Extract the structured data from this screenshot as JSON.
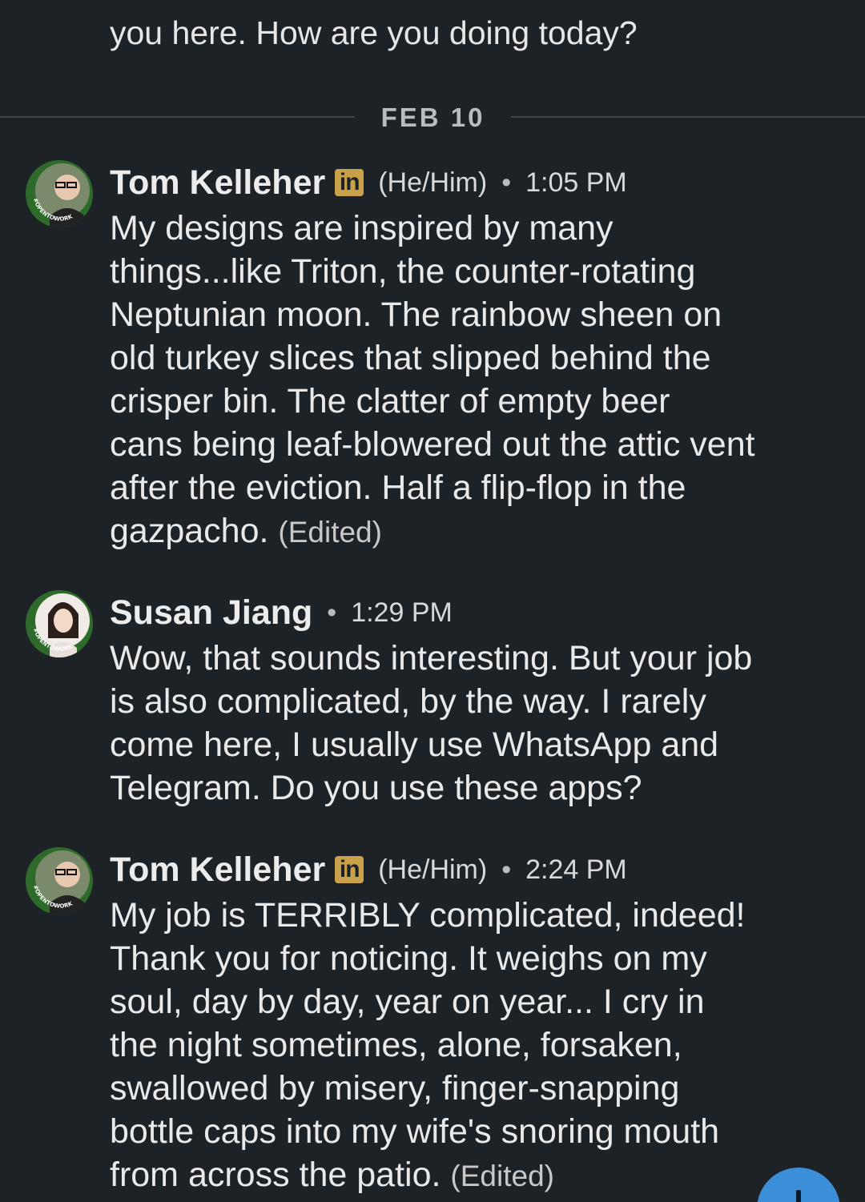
{
  "previous_message": {
    "text_tail": "you here. How are you doing today?"
  },
  "date_divider": "FEB 10",
  "messages": [
    {
      "sender": "Tom Kelleher",
      "badge": "in",
      "pronouns": "(He/Him)",
      "separator": "•",
      "time": "1:05 PM",
      "avatar_icon": "avatar-opentowork-frame",
      "avatar_frame_text": "#OPENTOWORK",
      "text": "My designs are inspired by many\nthings...like Triton, the counter-rotating\nNeptunian moon.  The rainbow sheen on\nold turkey slices that slipped behind the\ncrisper bin.  The clatter of empty beer\ncans being leaf-blowered out the attic vent\nafter the eviction.  Half a flip-flop in the\ngazpacho.",
      "edited": "(Edited)"
    },
    {
      "sender": "Susan Jiang",
      "separator": "•",
      "time": "1:29 PM",
      "avatar_icon": "avatar-opentowork-frame",
      "avatar_frame_text": "#OPENTOWORK",
      "text": "Wow, that sounds interesting. But your job\nis also complicated, by the way. I rarely\ncome here, I usually use WhatsApp and\nTelegram. Do you use these apps?"
    },
    {
      "sender": "Tom Kelleher",
      "badge": "in",
      "pronouns": "(He/Him)",
      "separator": "•",
      "time": "2:24 PM",
      "avatar_icon": "avatar-opentowork-frame",
      "avatar_frame_text": "#OPENTOWORK",
      "text": "My job is TERRIBLY complicated, indeed!\nThank you for noticing.  It weighs on my\nsoul, day by day, year on year... I cry in\nthe night sometimes, alone, forsaken,\nswallowed by misery, finger-snapping\nbottle caps into my wife's snoring mouth\nfrom across the patio.",
      "edited": "(Edited)"
    }
  ],
  "fab": {
    "icon": "plus-icon",
    "color": "#3b8fd9"
  },
  "colors": {
    "background": "#1d2226",
    "text": "#e9e9e9",
    "badge": "#c9a14a",
    "opentowork_frame": "#2e6b2a"
  }
}
